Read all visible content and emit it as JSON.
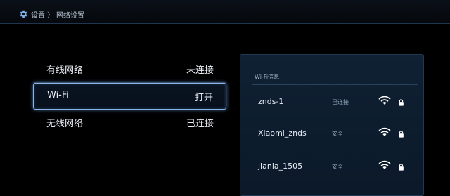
{
  "header": {
    "title": "设置",
    "page": "网络设置",
    "separator": "〉",
    "icon": "gear-icon"
  },
  "menu": {
    "items": [
      {
        "label": "有线网络",
        "value": "未连接",
        "selected": false
      },
      {
        "label": "Wi-Fi",
        "value": "打开",
        "selected": true
      },
      {
        "label": "无线网络",
        "value": "已连接",
        "selected": false
      }
    ]
  },
  "wifi_panel": {
    "title": "Wi-Fi信息",
    "networks": [
      {
        "name": "znds-1",
        "status": "已连接",
        "icons": [
          "wifi-signal-icon",
          "lock-icon"
        ]
      },
      {
        "name": "Xiaomi_znds",
        "status": "安全",
        "icons": [
          "wifi-signal-icon",
          "lock-icon"
        ]
      },
      {
        "name": "jianla_1505",
        "status": "安全",
        "icons": [
          "wifi-signal-icon",
          "lock-icon"
        ]
      }
    ]
  },
  "colors": {
    "background": "#000000",
    "accent_border": "#8ab4e6",
    "panel": "#0f2133"
  }
}
